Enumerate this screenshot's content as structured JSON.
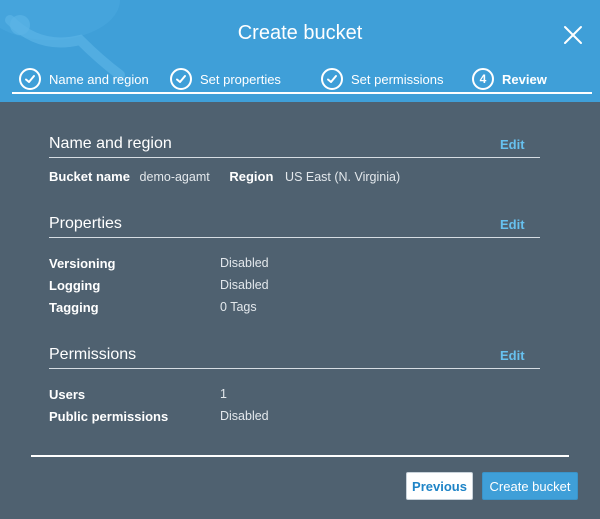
{
  "modal": {
    "title": "Create bucket"
  },
  "steps": [
    {
      "label": "Name and region",
      "state": "complete"
    },
    {
      "label": "Set properties",
      "state": "complete"
    },
    {
      "label": "Set permissions",
      "state": "complete"
    },
    {
      "number": "4",
      "label": "Review",
      "state": "current"
    }
  ],
  "name_region": {
    "title": "Name and region",
    "edit_label": "Edit",
    "bucket_name_label": "Bucket name",
    "bucket_name_value": "demo-agamt",
    "region_label": "Region",
    "region_value": "US East (N. Virginia)"
  },
  "properties": {
    "title": "Properties",
    "edit_label": "Edit",
    "rows": [
      {
        "label": "Versioning",
        "value": "Disabled"
      },
      {
        "label": "Logging",
        "value": "Disabled"
      },
      {
        "label": "Tagging",
        "value": "0 Tags"
      }
    ]
  },
  "permissions": {
    "title": "Permissions",
    "edit_label": "Edit",
    "rows": [
      {
        "label": "Users",
        "value": "1"
      },
      {
        "label": "Public permissions",
        "value": "Disabled"
      }
    ]
  },
  "footer": {
    "previous_label": "Previous",
    "create_label": "Create bucket"
  },
  "colors": {
    "header": "#3f9fd8",
    "body": "#4f6170",
    "edit_link": "#67c1ef"
  },
  "icons": {
    "close": "close-icon",
    "step_complete": "check-circle-icon"
  }
}
